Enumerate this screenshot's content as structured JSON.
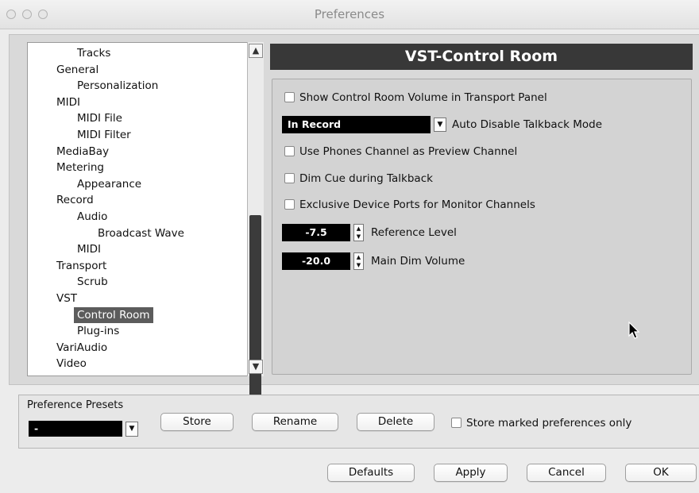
{
  "window": {
    "title": "Preferences"
  },
  "tree": {
    "items": [
      {
        "label": "Tracks",
        "level": 2
      },
      {
        "label": "General",
        "level": 1
      },
      {
        "label": "Personalization",
        "level": 2
      },
      {
        "label": "MIDI",
        "level": 1
      },
      {
        "label": "MIDI File",
        "level": 2
      },
      {
        "label": "MIDI Filter",
        "level": 2
      },
      {
        "label": "MediaBay",
        "level": 1
      },
      {
        "label": "Metering",
        "level": 1
      },
      {
        "label": "Appearance",
        "level": 2
      },
      {
        "label": "Record",
        "level": 1
      },
      {
        "label": "Audio",
        "level": 2
      },
      {
        "label": "Broadcast Wave",
        "level": 3
      },
      {
        "label": "MIDI",
        "level": 2
      },
      {
        "label": "Transport",
        "level": 1
      },
      {
        "label": "Scrub",
        "level": 2
      },
      {
        "label": "VST",
        "level": 1
      },
      {
        "label": "Control Room",
        "level": 2,
        "selected": true
      },
      {
        "label": "Plug-ins",
        "level": 2
      },
      {
        "label": "VariAudio",
        "level": 1
      },
      {
        "label": "Video",
        "level": 1
      }
    ]
  },
  "panel": {
    "title": "VST-Control Room",
    "show_volume_label": "Show Control Room Volume in Transport Panel",
    "talkback_select_value": "In Record",
    "talkback_label": "Auto Disable Talkback Mode",
    "phones_label": "Use Phones Channel as Preview Channel",
    "dim_cue_label": "Dim Cue during Talkback",
    "exclusive_ports_label": "Exclusive Device Ports for Monitor Channels",
    "reference_level_value": "-7.5",
    "reference_level_label": "Reference Level",
    "main_dim_value": "-20.0",
    "main_dim_label": "Main Dim Volume"
  },
  "presets": {
    "heading": "Preference Presets",
    "selected_value": "-",
    "store_label": "Store",
    "rename_label": "Rename",
    "delete_label": "Delete",
    "store_marked_label": "Store marked preferences only"
  },
  "footer": {
    "defaults_label": "Defaults",
    "apply_label": "Apply",
    "cancel_label": "Cancel",
    "ok_label": "OK"
  }
}
